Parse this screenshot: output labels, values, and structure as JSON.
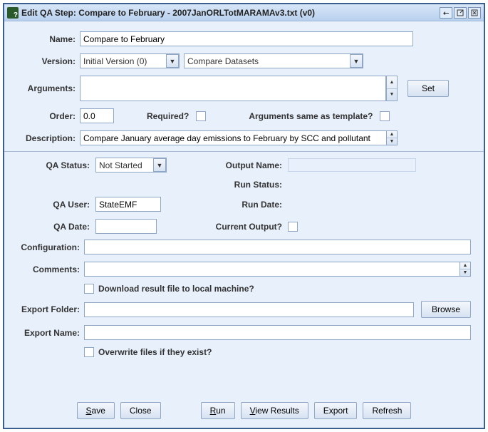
{
  "title": "Edit QA Step: Compare to February - 2007JanORLTotMARAMAv3.txt (v0)",
  "labels": {
    "name": "Name:",
    "version": "Version:",
    "arguments": "Arguments:",
    "order": "Order:",
    "required": "Required?",
    "argsSame": "Arguments same as template?",
    "description": "Description:",
    "qaStatus": "QA Status:",
    "qaUser": "QA User:",
    "qaDate": "QA Date:",
    "outputName": "Output Name:",
    "runStatus": "Run Status:",
    "runDate": "Run Date:",
    "currentOutput": "Current Output?",
    "configuration": "Configuration:",
    "comments": "Comments:",
    "downloadResult": "Download result file to local machine?",
    "exportFolder": "Export Folder:",
    "exportName": "Export Name:",
    "overwrite": "Overwrite files if they exist?"
  },
  "fields": {
    "name": "Compare to February",
    "version": "Initial Version (0)",
    "program": "Compare Datasets",
    "arguments": "",
    "order": "0.0",
    "description": "Compare January average day emissions to February by SCC and pollutant",
    "qaStatus": "Not Started",
    "qaUser": "StateEMF",
    "qaDate": "",
    "outputName": "",
    "configuration": "",
    "comments": "",
    "exportFolder": "",
    "exportName": ""
  },
  "buttons": {
    "set": "Set",
    "browse": "Browse",
    "save": "Save",
    "close": "Close",
    "run": "Run",
    "viewResults": "View Results",
    "export": "Export",
    "refresh": "Refresh"
  }
}
